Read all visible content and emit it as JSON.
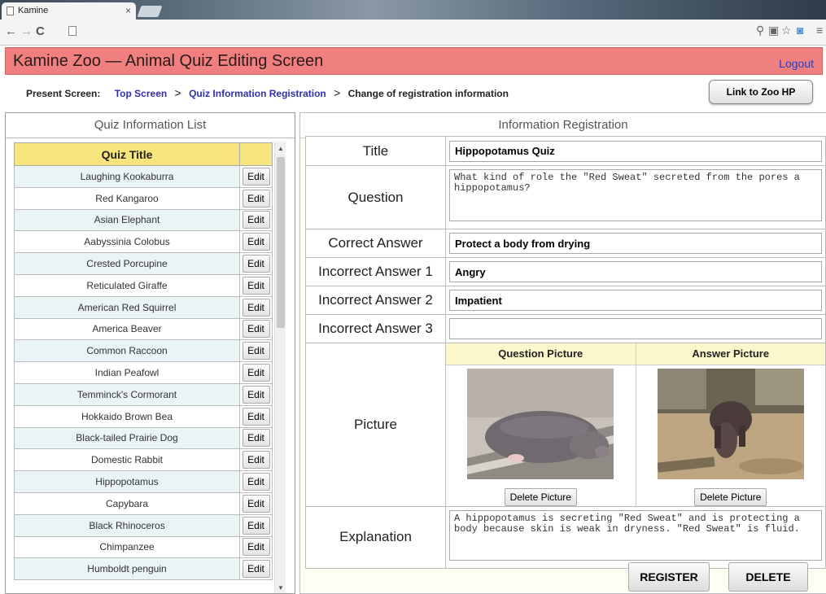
{
  "browser": {
    "tab_title": "Kamine",
    "tab_close": "×"
  },
  "header": {
    "title": "Kamine Zoo — Animal Quiz Editing Screen",
    "logout": "Logout",
    "accent_color": "#f08080"
  },
  "breadcrumb": {
    "prefix": "Present Screen:",
    "items": [
      "Top Screen",
      "Quiz Information Registration",
      "Change of registration information"
    ],
    "separator": ">",
    "zoo_link": "Link to Zoo HP"
  },
  "quiz_list": {
    "panel_title": "Quiz Information List",
    "column_title": "Quiz Title",
    "edit_label": "Edit",
    "items": [
      "Laughing Kookaburra",
      "Red Kangaroo",
      "Asian Elephant",
      "Aabyssinia Colobus",
      "Crested Porcupine",
      "Reticulated Giraffe",
      "American Red Squirrel",
      "America Beaver",
      "Common Raccoon",
      "Indian Peafowl",
      "Temminck's Cormorant",
      "Hokkaido Brown Bea",
      "Black-tailed Prairie Dog",
      "Domestic Rabbit",
      "Hippopotamus",
      "Capybara",
      "Black Rhinoceros",
      "Chimpanzee",
      "Humboldt penguin"
    ]
  },
  "form": {
    "panel_title": "Information Registration",
    "title_label": "Title",
    "title_value": "Hippopotamus Quiz",
    "question_label": "Question",
    "question_value": "What kind of role the \"Red Sweat\" secreted from the pores a hippopotamus?",
    "correct_label": "Correct Answer",
    "correct_value": "Protect a body from drying",
    "incorrect1_label": "Incorrect Answer 1",
    "incorrect1_value": "Angry",
    "incorrect2_label": "Incorrect Answer 2",
    "incorrect2_value": "Impatient",
    "incorrect3_label": "Incorrect Answer 3",
    "incorrect3_value": "",
    "picture_label": "Picture",
    "question_picture": "Question Picture",
    "answer_picture": "Answer Picture",
    "delete_picture": "Delete Picture",
    "explanation_label": "Explanation",
    "explanation_value": "A hippopotamus is secreting \"Red Sweat\" and is protecting a body because skin is weak in dryness. \"Red Sweat\" is fluid."
  },
  "actions": {
    "register": "REGISTER",
    "delete": "DELETE"
  }
}
